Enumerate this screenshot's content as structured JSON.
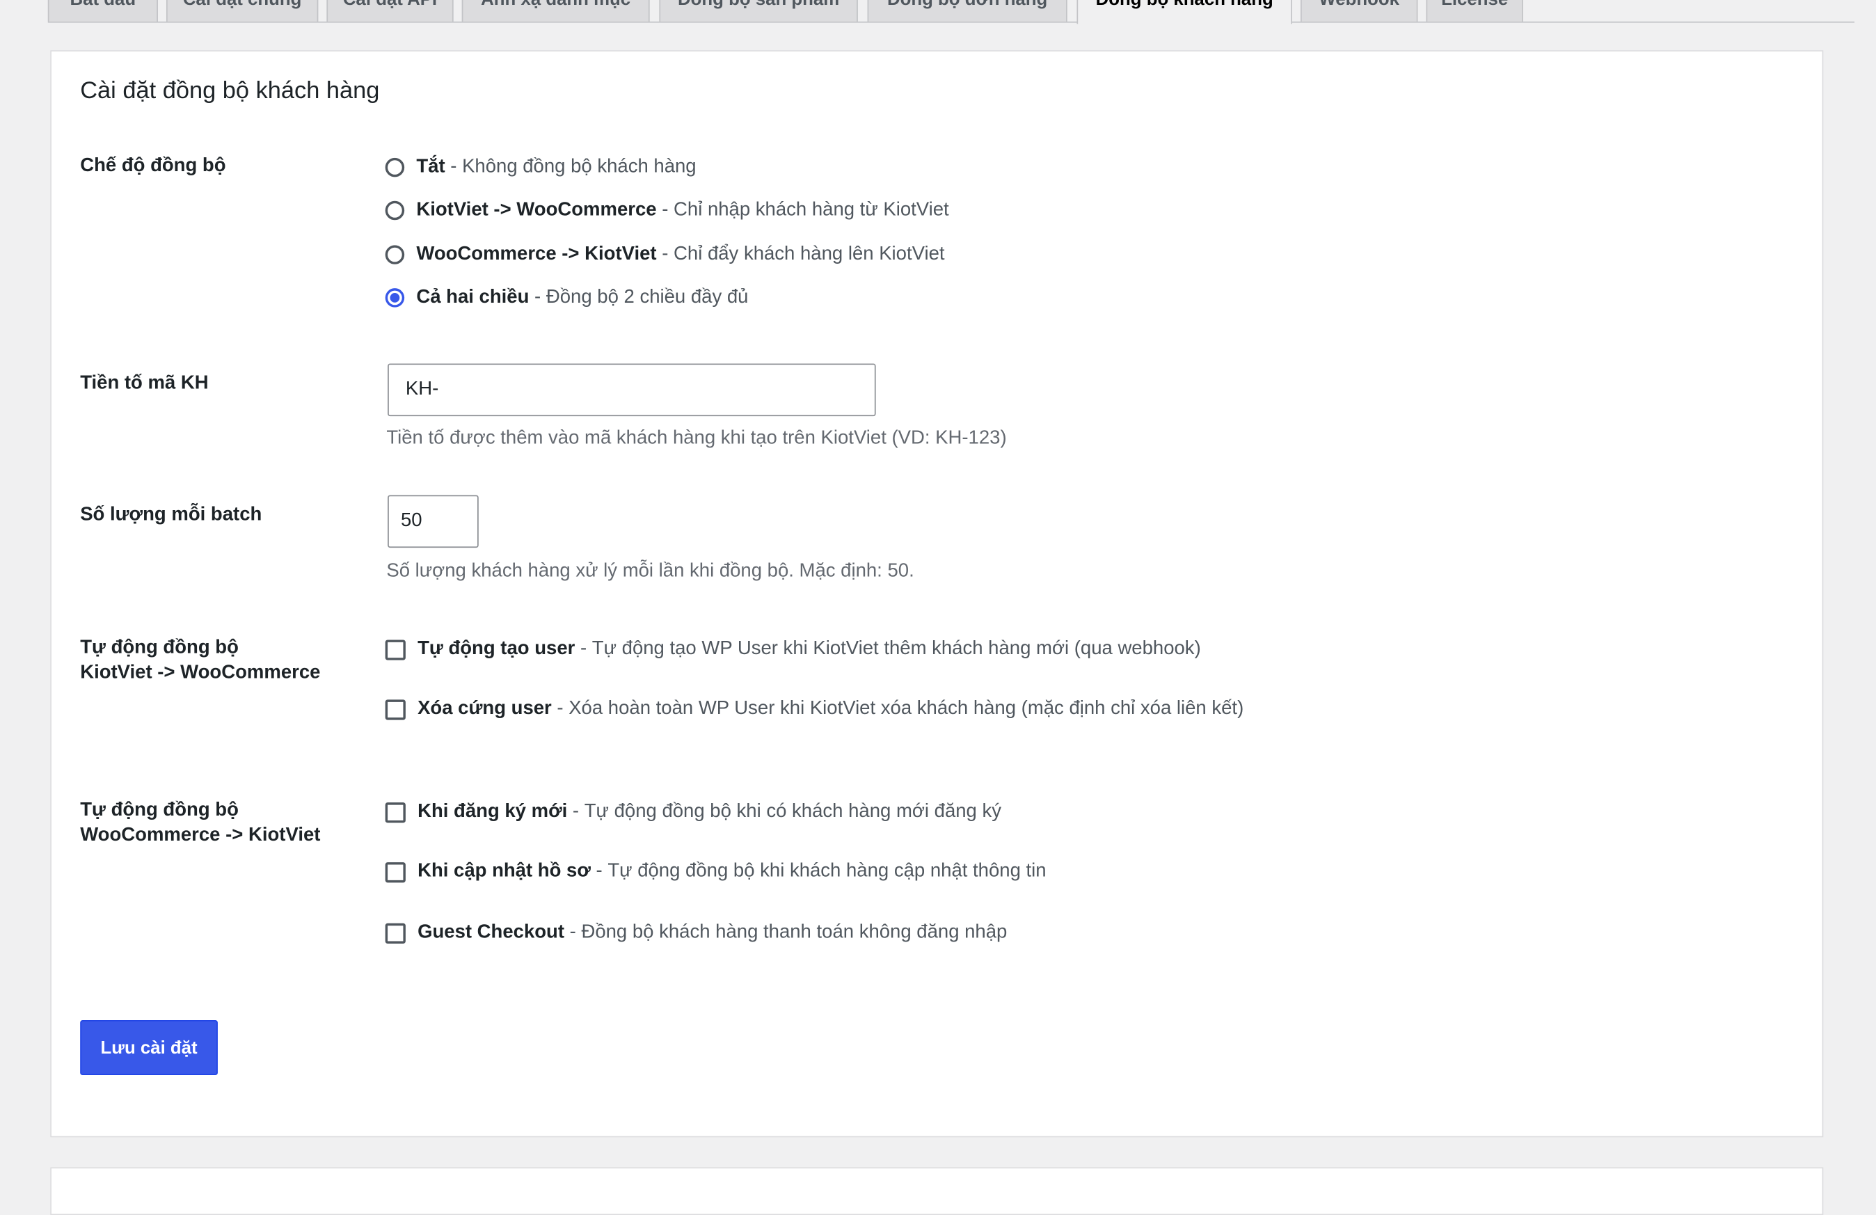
{
  "tabs": [
    {
      "label": "Bắt đầu"
    },
    {
      "label": "Cài đặt chung"
    },
    {
      "label": "Cài đặt API"
    },
    {
      "label": "Ánh xạ danh mục"
    },
    {
      "label": "Đồng bộ sản phẩm"
    },
    {
      "label": "Đồng bộ đơn hàng"
    },
    {
      "label": "Đồng bộ khách hàng",
      "active": true
    },
    {
      "label": "Webhook"
    },
    {
      "label": "License"
    }
  ],
  "section": {
    "title": "Cài đặt đồng bộ khách hàng"
  },
  "sync_mode": {
    "label": "Chế độ đồng bộ",
    "options": [
      {
        "name": "Tắt",
        "desc": "Không đồng bộ khách hàng",
        "checked": false
      },
      {
        "name": "KiotViet -> WooCommerce",
        "desc": "Chỉ nhập khách hàng từ KiotViet",
        "checked": false
      },
      {
        "name": "WooCommerce -> KiotViet",
        "desc": "Chỉ đẩy khách hàng lên KiotViet",
        "checked": false
      },
      {
        "name": "Cả hai chiều",
        "desc": "Đồng bộ 2 chiều đầy đủ",
        "checked": true
      }
    ]
  },
  "prefix": {
    "label": "Tiền tố mã KH",
    "value": "KH-",
    "help": "Tiền tố được thêm vào mã khách hàng khi tạo trên KiotViet (VD: KH-123)"
  },
  "batch": {
    "label": "Số lượng mỗi batch",
    "value": "50",
    "help": "Số lượng khách hàng xử lý mỗi lần khi đồng bộ. Mặc định: 50."
  },
  "auto_kv_to_wc": {
    "label_line1": "Tự động đồng bộ",
    "label_line2": "KiotViet -> WooCommerce",
    "options": [
      {
        "name": "Tự động tạo user",
        "desc": "Tự động tạo WP User khi KiotViet thêm khách hàng mới (qua webhook)",
        "checked": false
      },
      {
        "name": "Xóa cứng user",
        "desc": "Xóa hoàn toàn WP User khi KiotViet xóa khách hàng (mặc định chỉ xóa liên kết)",
        "checked": false
      }
    ]
  },
  "auto_wc_to_kv": {
    "label_line1": "Tự động đồng bộ",
    "label_line2": "WooCommerce -> KiotViet",
    "options": [
      {
        "name": "Khi đăng ký mới",
        "desc": "Tự động đồng bộ khi có khách hàng mới đăng ký",
        "checked": false
      },
      {
        "name": "Khi cập nhật hồ sơ",
        "desc": "Tự động đồng bộ khi khách hàng cập nhật thông tin",
        "checked": false
      },
      {
        "name": "Guest Checkout",
        "desc": "Đồng bộ khách hàng thanh toán không đăng nhập",
        "checked": false
      }
    ]
  },
  "separator": " - ",
  "save_button": "Lưu cài đặt",
  "colors": {
    "accent": "#3858e9",
    "background": "#f0f0f1",
    "text": "#1d2327",
    "muted": "#646970"
  }
}
